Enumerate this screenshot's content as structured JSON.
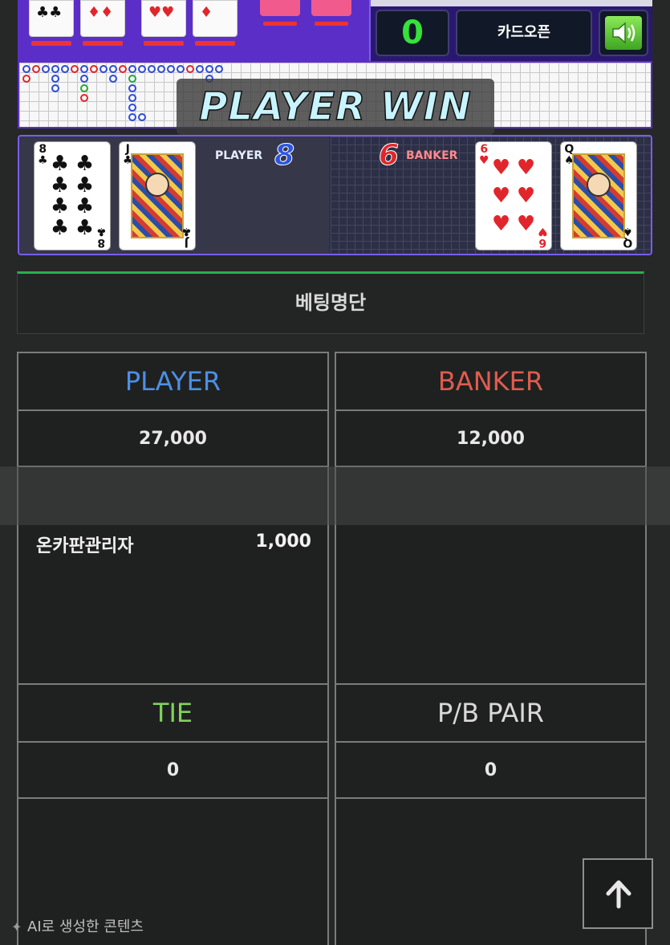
{
  "game": {
    "count": "0",
    "open_button": "카드오픈",
    "result_banner": "PLAYER WIN",
    "player_label": "PLAYER",
    "player_score": "8",
    "banker_label": "BANKER",
    "banker_score": "6",
    "player_cards": [
      {
        "rank": "8",
        "suit": "♣"
      },
      {
        "rank": "J",
        "suit": "♣"
      }
    ],
    "banker_cards": [
      {
        "rank": "6",
        "suit": "♥"
      },
      {
        "rank": "Q",
        "suit": "♠"
      }
    ],
    "sound_icon": "speaker-icon"
  },
  "bet_list": {
    "title": "베팅명단",
    "player": {
      "label": "PLAYER",
      "total": "27,000",
      "color": "#4d8fe6",
      "entries": [
        {
          "name": "온카판관리자",
          "amount": "1,000"
        }
      ]
    },
    "banker": {
      "label": "BANKER",
      "total": "12,000",
      "color": "#e05b4f"
    },
    "tie": {
      "label": "TIE",
      "total": "0",
      "color": "#7fd35b"
    },
    "pair": {
      "label": "P/B PAIR",
      "total": "0",
      "color": "#d9d9d9"
    }
  },
  "footer": {
    "ai_note": "AI로 생성한 콘텐츠",
    "scroll_top_icon": "arrow-up-icon"
  }
}
